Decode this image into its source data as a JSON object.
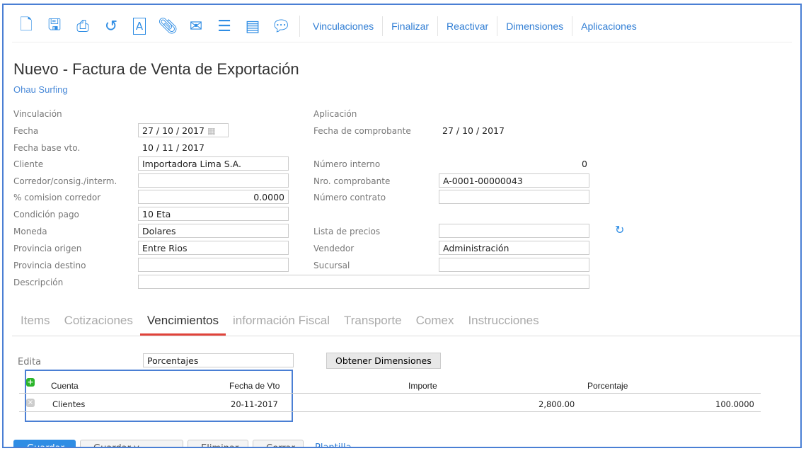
{
  "toolbar": {
    "icons": [
      "new-document-icon",
      "save-icon",
      "print-icon",
      "history-icon",
      "document-a-icon",
      "attach-icon",
      "mail-icon",
      "checklist-icon",
      "report-icon",
      "comment-icon"
    ],
    "links": [
      "Vinculaciones",
      "Finalizar",
      "Reactivar",
      "Dimensiones",
      "Aplicaciones"
    ]
  },
  "header": {
    "title": "Nuevo - Factura de Venta de Exportación",
    "company": "Ohau Surfing"
  },
  "form": {
    "vinculacion": "Vinculación",
    "aplicacion": "Aplicación",
    "fecha_label": "Fecha",
    "fecha": "27 / 10 / 2017",
    "fecha_comp_label": "Fecha de comprobante",
    "fecha_comp": "27 / 10 / 2017",
    "fecha_base_label": "Fecha base vto.",
    "fecha_base": "10 / 11 / 2017",
    "cliente_label": "Cliente",
    "cliente": "Importadora Lima S.A.",
    "num_interno_label": "Número interno",
    "num_interno": "0",
    "corredor_label": "Corredor/consig./interm.",
    "corredor": "",
    "nro_comp_label": "Nro. comprobante",
    "nro_comp": "A-0001-00000043",
    "comision_label": "% comision corredor",
    "comision": "0.0000",
    "contrato_label": "Número contrato",
    "contrato": "",
    "condicion_label": "Condición pago",
    "condicion": "10 Eta",
    "moneda_label": "Moneda",
    "moneda": "Dolares",
    "lista_label": "Lista de precios",
    "lista": "",
    "prov_origen_label": "Provincia origen",
    "prov_origen": "Entre Rios",
    "vendedor_label": "Vendedor",
    "vendedor": "Administración",
    "prov_destino_label": "Provincia destino",
    "prov_destino": "",
    "sucursal_label": "Sucursal",
    "sucursal": "",
    "descripcion_label": "Descripción",
    "descripcion": ""
  },
  "tabs": [
    "Items",
    "Cotizaciones",
    "Vencimientos",
    "información Fiscal",
    "Transporte",
    "Comex",
    "Instrucciones"
  ],
  "venc": {
    "edita_label": "Edita",
    "edita": "Porcentajes",
    "obtener": "Obtener Dimensiones",
    "headers": [
      "Cuenta",
      "Fecha de Vto",
      "Importe",
      "Porcentaje"
    ],
    "rows": [
      {
        "cuenta": "Clientes",
        "fecha": "20-11-2017",
        "importe": "2,800.00",
        "porcentaje": "100.0000"
      }
    ]
  },
  "footer": {
    "buttons": [
      "Guardar",
      "Guardar y nuevo",
      "Eliminar",
      "Cerrar"
    ],
    "link": "Plantilla"
  }
}
